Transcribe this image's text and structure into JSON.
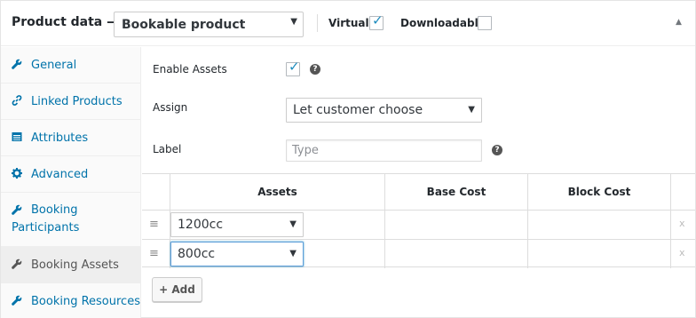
{
  "header": {
    "title": "Product data —",
    "product_type": "Bookable product",
    "virtual_label": "Virtual:",
    "virtual_checked": true,
    "downloadable_label": "Downloadable:",
    "downloadable_checked": false
  },
  "sidebar": {
    "items": [
      {
        "label": "General",
        "icon": "wrench-icon"
      },
      {
        "label": "Linked Products",
        "icon": "link-icon"
      },
      {
        "label": "Attributes",
        "icon": "list-icon"
      },
      {
        "label": "Advanced",
        "icon": "gear-icon"
      },
      {
        "label": "Booking Participants",
        "icon": "wrench-icon"
      },
      {
        "label": "Booking Assets",
        "icon": "wrench-icon",
        "active": true
      },
      {
        "label": "Booking Resources",
        "icon": "wrench-icon"
      }
    ]
  },
  "form": {
    "enable_assets_label": "Enable Assets",
    "enable_assets_checked": true,
    "assign_label": "Assign",
    "assign_value": "Let customer choose",
    "label_label": "Label",
    "label_placeholder": "Type"
  },
  "table": {
    "headers": [
      "Assets",
      "Base Cost",
      "Block Cost"
    ],
    "rows": [
      {
        "asset": "1200cc",
        "base_cost": "",
        "block_cost": ""
      },
      {
        "asset": "800cc",
        "base_cost": "",
        "block_cost": ""
      }
    ],
    "remove_symbol": "x",
    "handle_symbol": "≡"
  },
  "add_button_label": "+ Add",
  "colors": {
    "link": "#0073aa",
    "checkmark": "#1e8cbe",
    "focus_border": "#5b9dd9"
  }
}
